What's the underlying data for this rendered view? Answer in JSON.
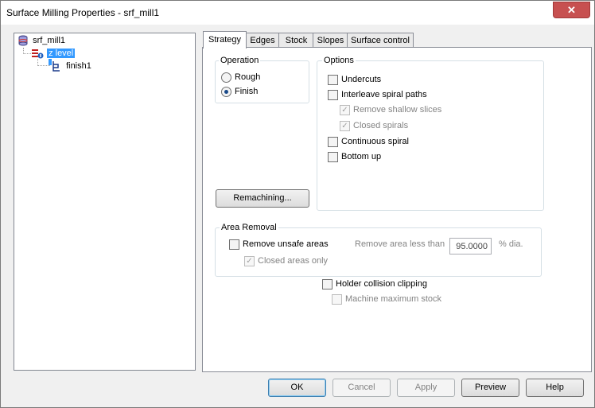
{
  "window": {
    "title": "Surface Milling Properties - srf_mill1",
    "close_glyph": "✕"
  },
  "tree": {
    "items": [
      {
        "label": "srf_mill1",
        "icon": "database-icon"
      },
      {
        "label": "z level",
        "icon": "zlevel-icon",
        "selected": true
      },
      {
        "label": "finish1",
        "icon": "finish-path-icon"
      }
    ]
  },
  "tabs": [
    {
      "label": "Strategy",
      "active": true
    },
    {
      "label": "Edges"
    },
    {
      "label": "Stock"
    },
    {
      "label": "Slopes"
    },
    {
      "label": "Surface control"
    }
  ],
  "operation": {
    "title": "Operation",
    "options": [
      {
        "label": "Rough",
        "selected": false
      },
      {
        "label": "Finish",
        "selected": true
      }
    ]
  },
  "options": {
    "title": "Options",
    "undercuts": "Undercuts",
    "interleave": "Interleave spiral paths",
    "remove_shallow": "Remove shallow slices",
    "closed_spirals": "Closed spirals",
    "continuous_spiral": "Continuous spiral",
    "bottom_up": "Bottom up"
  },
  "remachining_button": "Remachining...",
  "area_removal": {
    "title": "Area Removal",
    "remove_unsafe": "Remove unsafe areas",
    "closed_areas": "Closed areas only",
    "remove_less_than_label": "Remove area less than",
    "remove_less_than_value": "95.0000",
    "unit": "% dia."
  },
  "holder_collision": "Holder collision clipping",
  "machine_max_stock": "Machine maximum stock",
  "buttons": {
    "ok": "OK",
    "cancel": "Cancel",
    "apply": "Apply",
    "preview": "Preview",
    "help": "Help"
  },
  "check_glyph": "✓"
}
